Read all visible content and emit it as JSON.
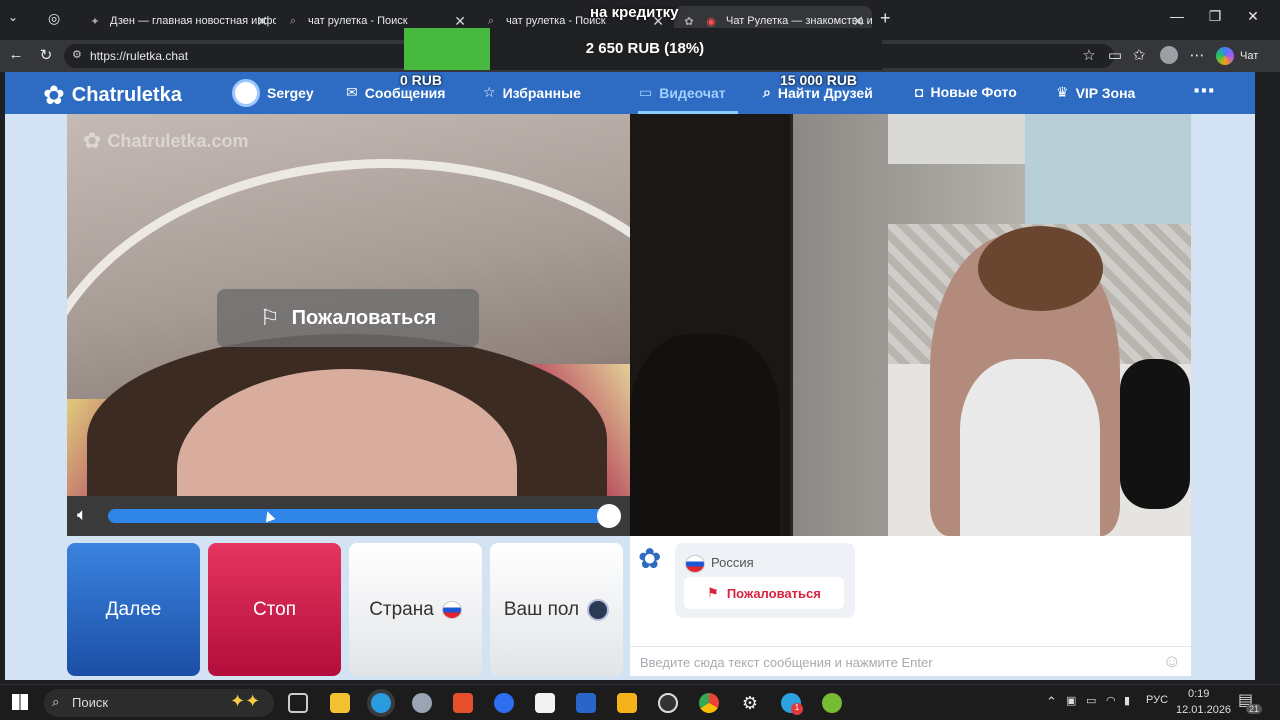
{
  "browser": {
    "tabs": [
      {
        "label": "Дзен — главная новостная инфо",
        "icon": "dzen-icon"
      },
      {
        "label": "чат рулетка - Поиск",
        "icon": "search-icon"
      },
      {
        "label": "чат рулетка - Поиск",
        "icon": "search-icon"
      },
      {
        "label": "Чат Рулетка — знакомства и",
        "icon": "chatruletka-icon",
        "active": true
      }
    ],
    "url": "https://ruletka.chat",
    "copilot_label": "Чат"
  },
  "overlay": {
    "top_text": "на кредитку",
    "amount": "2 650 RUB (18%)",
    "progress_fraction": 0.18,
    "left_value": "0 RUB",
    "right_value": "15 000 RUB",
    "fill_color": "#47b93e"
  },
  "site": {
    "logo_text": "Chatruletka",
    "nav": {
      "user": "Sergey",
      "messages": "Сообщения",
      "favorites": "Избранные",
      "videochat": "Видеочат",
      "find_friends": "Найти Друзей",
      "new_photo": "Новые Фото",
      "vip": "VIP Зона"
    },
    "brand_color": "#2d6cc2"
  },
  "video": {
    "watermark": "Chatruletka.com",
    "report_button": "Пожаловаться",
    "volume_fraction": 1.0
  },
  "buttons": {
    "next": "Далее",
    "stop": "Стоп",
    "country": "Страна",
    "gender": "Ваш пол"
  },
  "chat": {
    "partner_country": "Россия",
    "report_label": "Пожаловаться",
    "input_placeholder": "Введите сюда текст сообщения и нажмите Enter"
  },
  "taskbar": {
    "search_placeholder": "Поиск",
    "language": "РУС",
    "time": "0:19",
    "date": "12.01.2026",
    "notification_count": "21",
    "telegram_badge": "1"
  }
}
